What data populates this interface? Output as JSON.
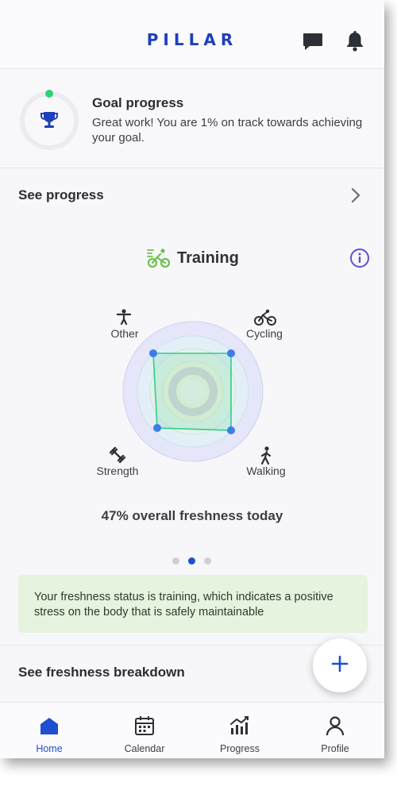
{
  "header": {
    "logo_text": "PILLAR",
    "icons": [
      "chat-icon",
      "bell-icon"
    ]
  },
  "goal": {
    "title": "Goal progress",
    "message": "Great work! You are 1% on track towards achieving your goal.",
    "progress_fraction": 0.01,
    "icon": "trophy-icon"
  },
  "see_progress": {
    "label": "See progress",
    "icon": "chevron-right-icon"
  },
  "training": {
    "title": "Training",
    "icon": "cyclist-icon",
    "info_icon": "info-icon",
    "axes": [
      {
        "label": "Other",
        "icon": "person-icon"
      },
      {
        "label": "Cycling",
        "icon": "bicycle-icon"
      },
      {
        "label": "Walking",
        "icon": "walker-icon"
      },
      {
        "label": "Strength",
        "icon": "dumbbell-icon"
      }
    ],
    "summary": "47% overall freshness today"
  },
  "pager": {
    "pages": 3,
    "active_index": 1
  },
  "status": {
    "message": "Your freshness status is training, which indicates a positive stress on the body that is safely maintainable"
  },
  "see_freshness": {
    "label": "See freshness breakdown"
  },
  "fab": {
    "icon": "plus-icon"
  },
  "tabs": [
    {
      "label": "Home",
      "icon": "home-icon",
      "active": true
    },
    {
      "label": "Calendar",
      "icon": "calendar-icon",
      "active": false
    },
    {
      "label": "Progress",
      "icon": "chart-icon",
      "active": false
    },
    {
      "label": "Profile",
      "icon": "person-icon",
      "active": false
    }
  ],
  "colors": {
    "brand": "#1d3fb8",
    "accent": "#1f4fd0",
    "training_green": "#6cc24a",
    "status_bg": "#e5f3df",
    "radar_point": "#3b7ee8"
  }
}
